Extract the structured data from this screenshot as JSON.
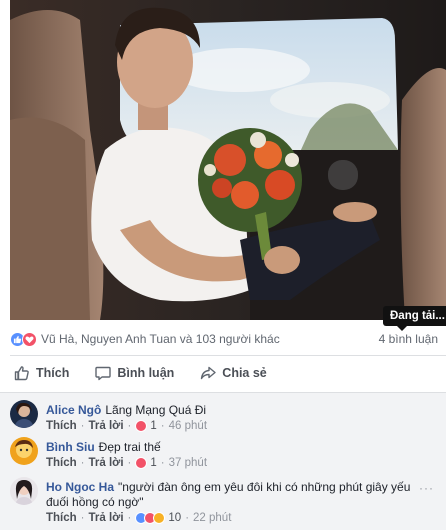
{
  "post": {
    "loading_tooltip": "Đang tải...",
    "reactions_text": "Vũ Hà, Nguyen Anh Tuan và 103 người khác",
    "comments_count": "4 bình luận"
  },
  "actions": {
    "like": "Thích",
    "comment": "Bình luận",
    "share": "Chia sẻ"
  },
  "comments": [
    {
      "name": "Alice Ngô",
      "text": "Lãng Mạng Quá Đi",
      "like_label": "Thích",
      "reply_label": "Trả lời",
      "reaction_count": "1",
      "time": "46 phút",
      "reactions": [
        "love"
      ]
    },
    {
      "name": "Bình Siu",
      "text": "Đẹp trai thế",
      "like_label": "Thích",
      "reply_label": "Trả lời",
      "reaction_count": "1",
      "time": "37 phút",
      "reactions": [
        "love"
      ]
    },
    {
      "name": "Ho Ngoc Ha",
      "text": "\"người đàn ông em yêu đôi khi có những phút giây yếu đuối hồng có ngờ\"",
      "like_label": "Thích",
      "reply_label": "Trả lời",
      "reaction_count": "10",
      "time": "22 phút",
      "reactions": [
        "like",
        "love",
        "haha"
      ]
    }
  ],
  "colors": {
    "link_blue": "#365899",
    "like_blue": "#5890ff",
    "love_red": "#f25268",
    "haha_yellow": "#f7b125",
    "muted": "#90949c"
  }
}
